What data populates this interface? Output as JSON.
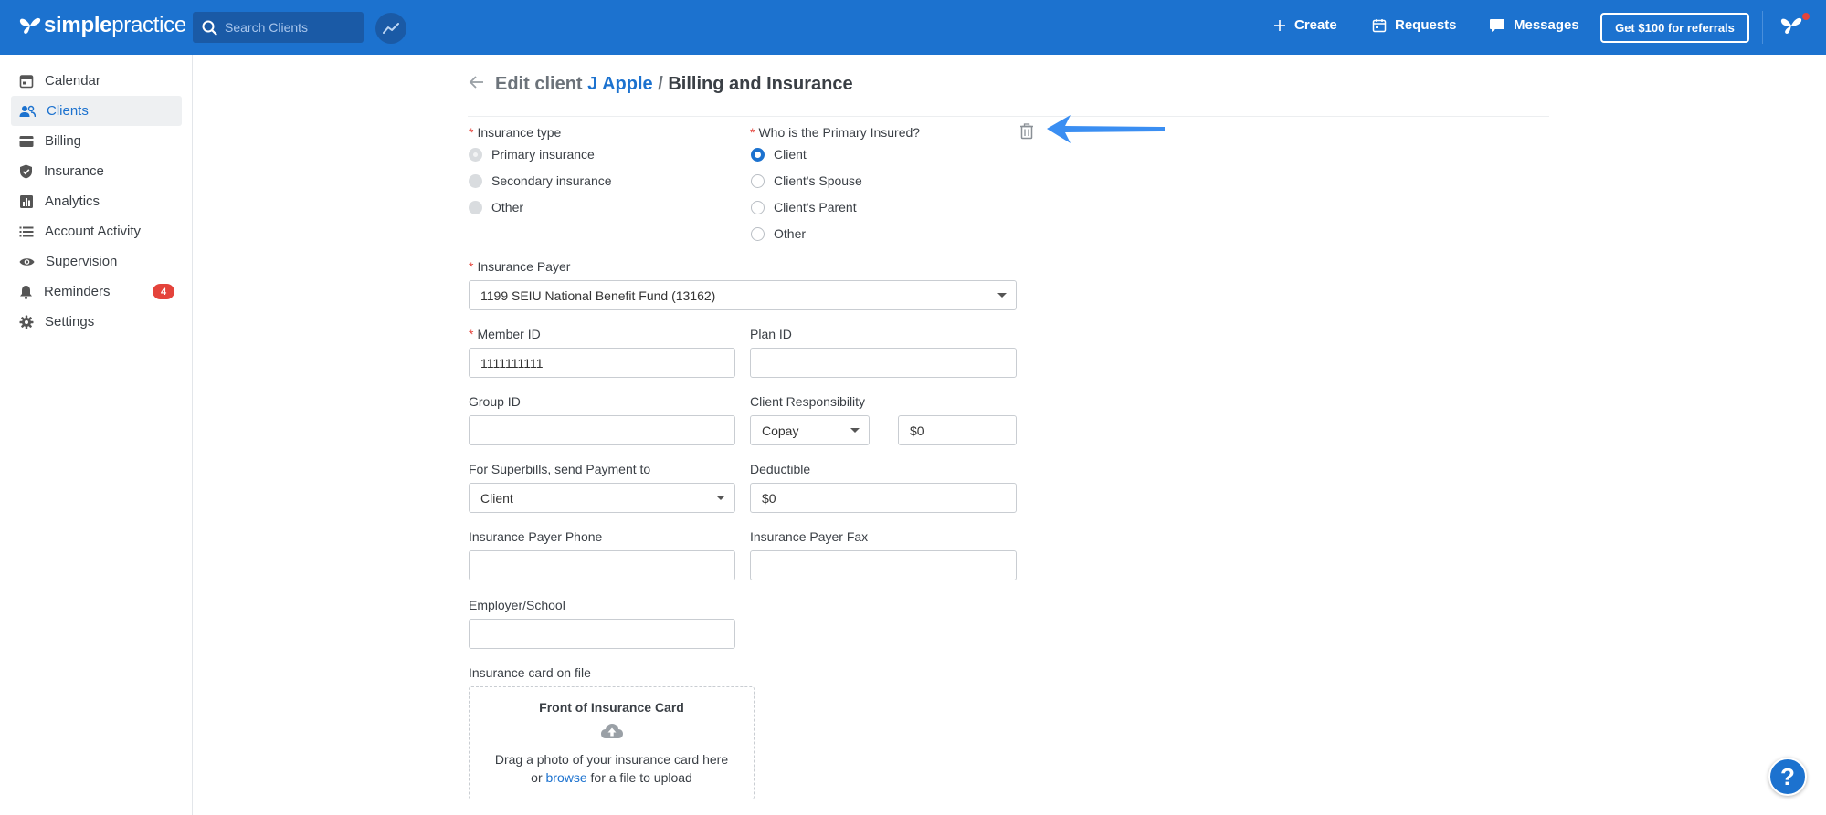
{
  "header": {
    "logo_text_bold": "simple",
    "logo_text_light": "practice",
    "search_placeholder": "Search Clients",
    "create_label": "Create",
    "requests_label": "Requests",
    "messages_label": "Messages",
    "referral_label": "Get $100 for referrals"
  },
  "sidebar": {
    "items": [
      {
        "label": "Calendar",
        "icon": "calendar-icon"
      },
      {
        "label": "Clients",
        "icon": "clients-icon",
        "active": true
      },
      {
        "label": "Billing",
        "icon": "billing-icon"
      },
      {
        "label": "Insurance",
        "icon": "shield-icon"
      },
      {
        "label": "Analytics",
        "icon": "analytics-icon"
      },
      {
        "label": "Account Activity",
        "icon": "list-icon"
      },
      {
        "label": "Supervision",
        "icon": "eye-icon"
      },
      {
        "label": "Reminders",
        "icon": "bell-icon",
        "badge": "4"
      },
      {
        "label": "Settings",
        "icon": "gear-icon"
      }
    ]
  },
  "page": {
    "title_prefix": "Edit client",
    "client_name": "J Apple",
    "separator": "/",
    "section": "Billing and Insurance"
  },
  "form": {
    "insurance_type": {
      "label": "Insurance type",
      "options": [
        "Primary insurance",
        "Secondary insurance",
        "Other"
      ],
      "selected": "Primary insurance"
    },
    "primary_insured": {
      "label": "Who is the Primary Insured?",
      "options": [
        "Client",
        "Client's Spouse",
        "Client's Parent",
        "Other"
      ],
      "selected": "Client"
    },
    "insurance_payer": {
      "label": "Insurance Payer",
      "value": "1199 SEIU National Benefit Fund (13162)"
    },
    "member_id": {
      "label": "Member ID",
      "value": "1111111111"
    },
    "plan_id": {
      "label": "Plan ID",
      "value": ""
    },
    "group_id": {
      "label": "Group ID",
      "value": ""
    },
    "client_responsibility": {
      "label": "Client Responsibility",
      "type_value": "Copay",
      "amount": "$0"
    },
    "superbills_payment": {
      "label": "For Superbills, send Payment to",
      "value": "Client"
    },
    "deductible": {
      "label": "Deductible",
      "value": "$0"
    },
    "payer_phone": {
      "label": "Insurance Payer Phone",
      "value": ""
    },
    "payer_fax": {
      "label": "Insurance Payer Fax",
      "value": ""
    },
    "employer_school": {
      "label": "Employer/School",
      "value": ""
    },
    "insurance_card": {
      "label": "Insurance card on file",
      "front_title": "Front of Insurance Card",
      "drag_text": "Drag a photo of your insurance card here",
      "or_text": "or",
      "browse_text": "browse",
      "upload_suffix": "for a file to upload"
    }
  },
  "help_label": "?",
  "colors": {
    "brand": "#1c72cf",
    "annotation_arrow": "#3a8ef2",
    "required": "#e4433b"
  }
}
